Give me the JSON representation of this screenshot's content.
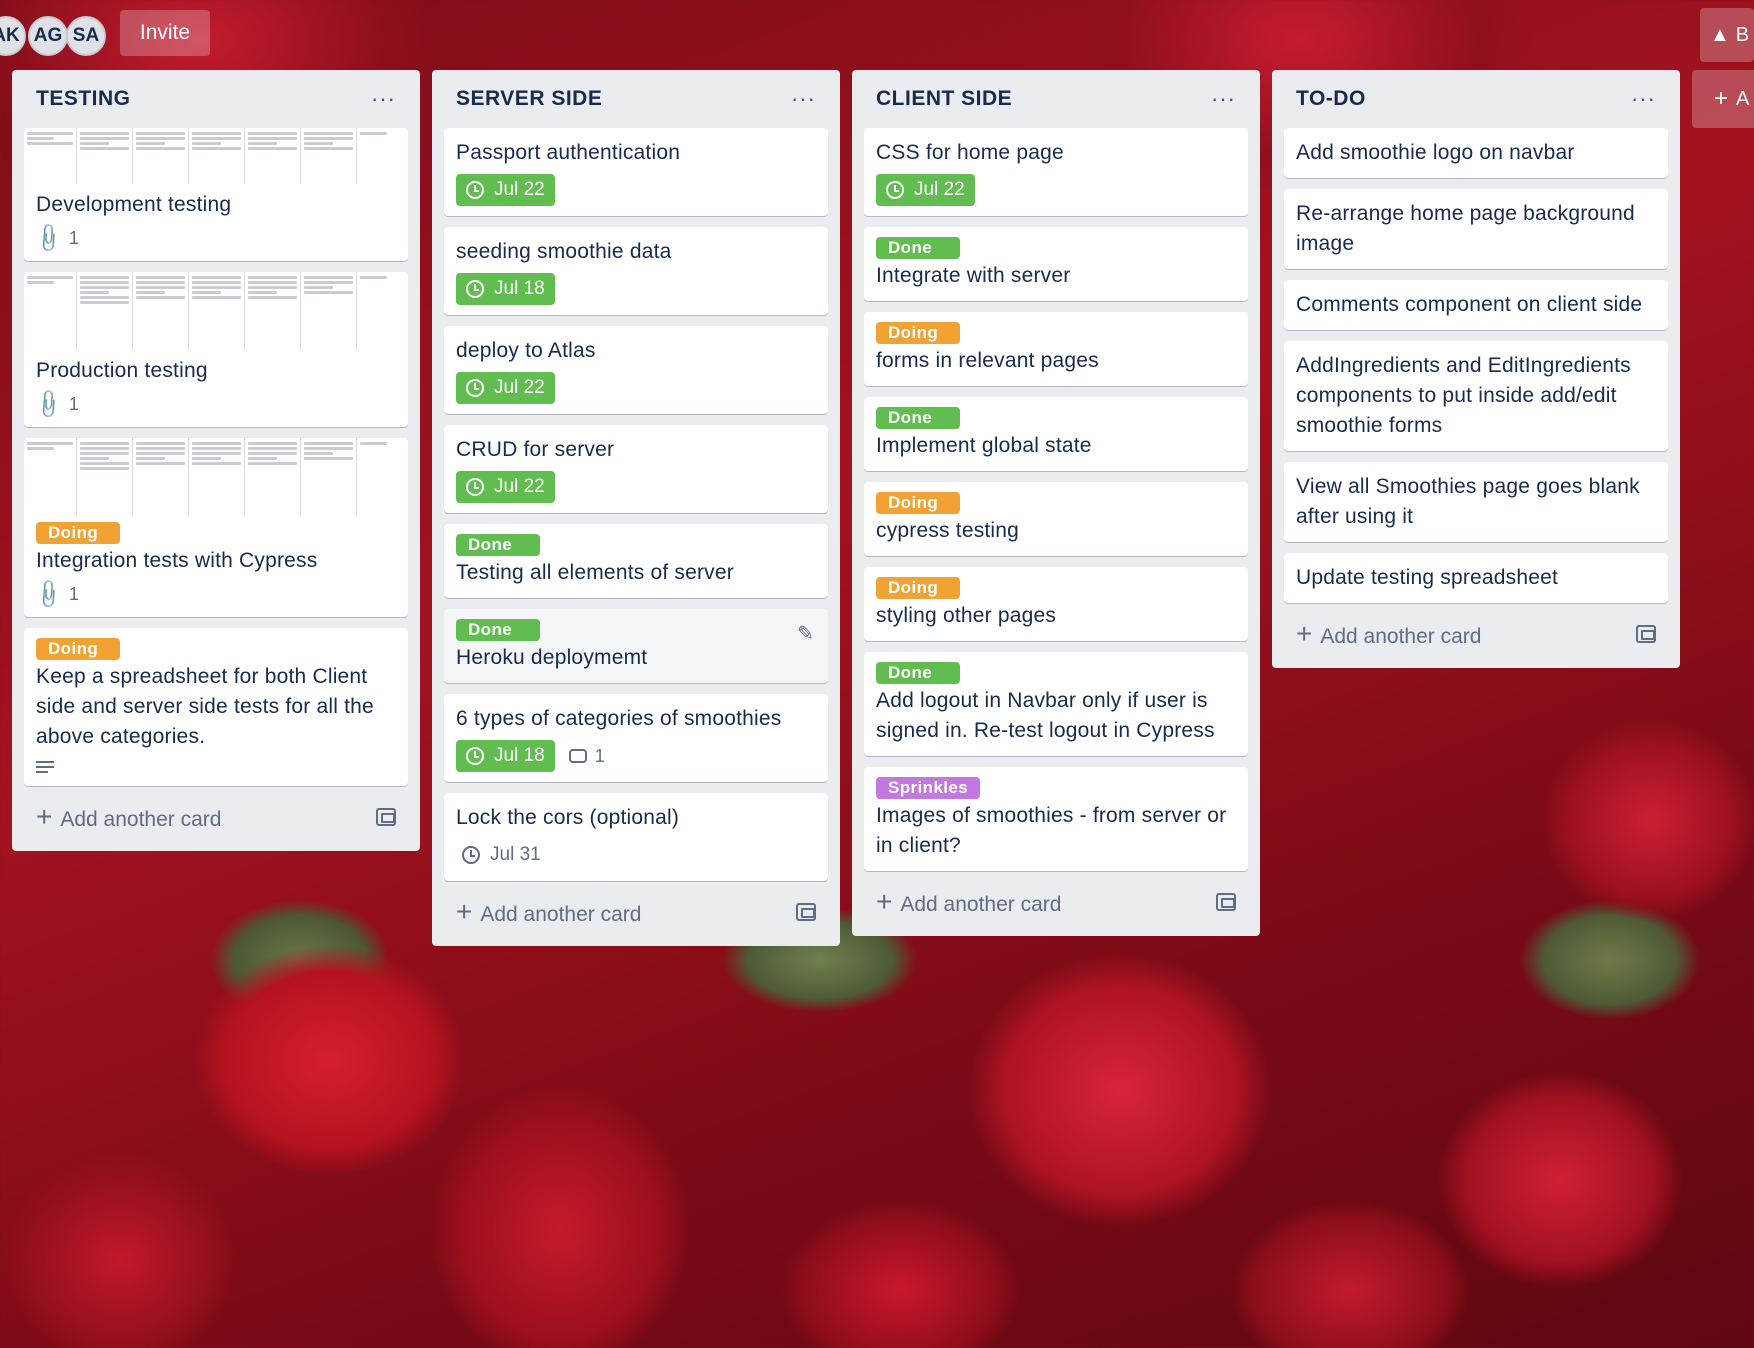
{
  "header": {
    "members": [
      "AK",
      "AG",
      "SA"
    ],
    "invite_label": "Invite",
    "right_label": "B",
    "add_list_label": "A"
  },
  "lists": [
    {
      "title": "TESTING",
      "add_label": "Add another card",
      "cards": [
        {
          "title": "Development testing",
          "attachments": "1"
        },
        {
          "title": "Production testing",
          "attachments": "1"
        },
        {
          "label": "Doing",
          "title": "Integration tests with Cypress",
          "attachments": "1"
        },
        {
          "label": "Doing",
          "title": "Keep a spreadsheet for both Client side and server side tests for all the above categories."
        }
      ]
    },
    {
      "title": "SERVER SIDE",
      "add_label": "Add another card",
      "cards": [
        {
          "title": "Passport authentication",
          "due": "Jul 22"
        },
        {
          "title": "seeding smoothie data",
          "due": "Jul 18"
        },
        {
          "title": "deploy to Atlas",
          "due": "Jul 22"
        },
        {
          "title": "CRUD for server",
          "due": "Jul 22"
        },
        {
          "label": "Done",
          "title": "Testing all elements of server"
        },
        {
          "label": "Done",
          "title": "Heroku deploymemt"
        },
        {
          "title": "6 types of categories of smoothies",
          "due": "Jul 18",
          "comments": "1"
        },
        {
          "title": "Lock the cors (optional)",
          "due": "Jul 31"
        }
      ]
    },
    {
      "title": "CLIENT SIDE",
      "add_label": "Add another card",
      "cards": [
        {
          "title": "CSS for home page",
          "due": "Jul 22"
        },
        {
          "label": "Done",
          "title": "Integrate with server"
        },
        {
          "label": "Doing",
          "title": "forms in relevant pages"
        },
        {
          "label": "Done",
          "title": "Implement global state"
        },
        {
          "label": "Doing",
          "title": "cypress testing"
        },
        {
          "label": "Doing",
          "title": "styling other pages"
        },
        {
          "label": "Done",
          "title": "Add logout in Navbar only if user is signed in. Re-test logout in Cypress"
        },
        {
          "label": "Sprinkles",
          "title": "Images of smoothies - from server or in client?"
        }
      ]
    },
    {
      "title": "TO-DO",
      "add_label": "Add another card",
      "cards": [
        {
          "title": "Add smoothie logo on navbar"
        },
        {
          "title": "Re-arrange home page background image"
        },
        {
          "title": "Comments component on client side"
        },
        {
          "title": "AddIngredients and EditIngredients components to put inside add/edit smoothie forms"
        },
        {
          "title": "View all Smoothies page goes blank after using it"
        },
        {
          "title": "Update testing spreadsheet"
        }
      ]
    }
  ],
  "colors": {
    "done": "#61bd4f",
    "doing": "#f2a133",
    "sprinkles": "#c377e0",
    "list_bg": "#ebecf0"
  }
}
